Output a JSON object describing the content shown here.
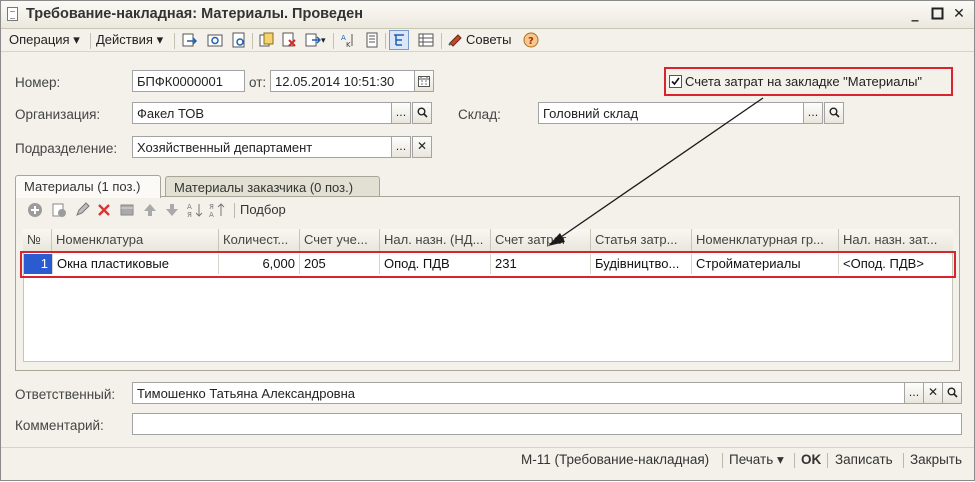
{
  "window": {
    "title": "Требование-накладная: Материалы. Проведен"
  },
  "toolbar": {
    "operation_label": "Операция",
    "actions_label": "Действия",
    "tips_label": "Советы"
  },
  "form": {
    "number_label": "Номер:",
    "number_value": "БПФК0000001",
    "date_label": "от:",
    "date_value": "12.05.2014 10:51:30",
    "checkbox_label": "Счета затрат на закладке \"Материалы\"",
    "checkbox_checked": true,
    "org_label": "Организация:",
    "org_value": "Факел ТОВ",
    "warehouse_label": "Склад:",
    "warehouse_value": "Головний склад",
    "dept_label": "Подразделение:",
    "dept_value": "Хозяйственный департамент"
  },
  "tabs": [
    {
      "label": "Материалы (1 поз.)",
      "active": true
    },
    {
      "label": "Материалы заказчика (0 поз.)",
      "active": false
    }
  ],
  "table_toolbar": {
    "pick_label": "Подбор"
  },
  "table": {
    "columns": [
      "№",
      "Номенклатура",
      "Количест...",
      "Счет уче...",
      "Нал. назн. (НД...",
      "Счет затрат",
      "Статья затр...",
      "Номенклатурная гр...",
      "Нал. назн. зат..."
    ],
    "rows": [
      [
        "1",
        "Окна пластиковые",
        "6,000",
        "205",
        "Опод. ПДВ",
        "231",
        "Будівництво...",
        "Стройматериалы",
        "<Опод. ПДВ>"
      ]
    ]
  },
  "footer": {
    "responsible_label": "Ответственный:",
    "responsible_value": "Тимошенко Татьяна Александровна",
    "comment_label": "Комментарий:",
    "comment_value": ""
  },
  "statusbar": {
    "form_label": "М-11 (Требование-накладная)",
    "print_label": "Печать",
    "ok_label": "OK",
    "save_label": "Записать",
    "close_label": "Закрыть"
  },
  "colors": {
    "highlight_red": "#d9232e",
    "selection_blue": "#2a5bd0",
    "window_bg": "#f3f1e9"
  }
}
